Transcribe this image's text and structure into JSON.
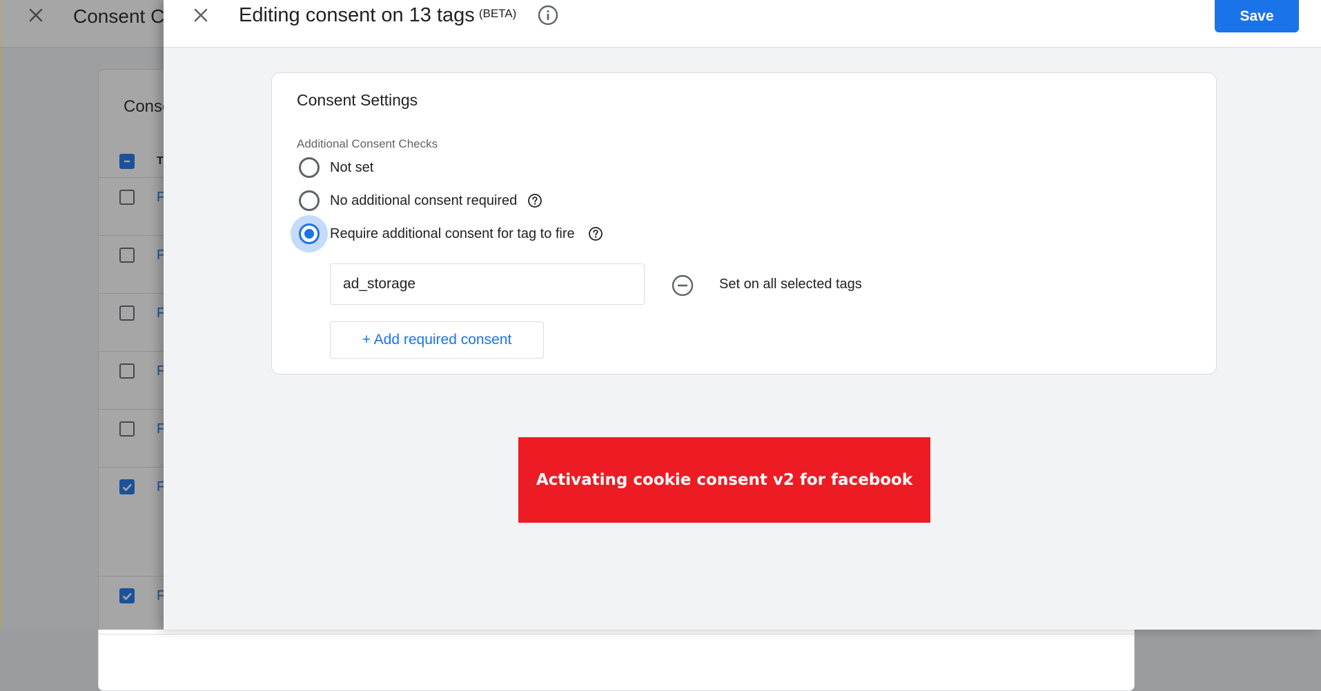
{
  "background_page": {
    "title": "Consent C",
    "card_title": "Conse",
    "table_header_initial": "T",
    "row_link_initial": "F",
    "rows": [
      {
        "checked": false
      },
      {
        "checked": false
      },
      {
        "checked": false
      },
      {
        "checked": false
      },
      {
        "checked": false
      },
      {
        "checked": true
      },
      {
        "checked": true
      }
    ]
  },
  "dialog": {
    "title": "Editing consent on 13 tags",
    "badge": "(BETA)",
    "save_label": "Save",
    "card": {
      "title": "Consent Settings",
      "section_label": "Additional Consent Checks",
      "options": [
        {
          "label": "Not set",
          "selected": false,
          "help": false
        },
        {
          "label": "No additional consent required",
          "selected": false,
          "help": true
        },
        {
          "label": "Require additional consent for tag to fire",
          "selected": true,
          "help": true
        }
      ],
      "consent_value": "ad_storage",
      "set_all_label": "Set on all selected tags",
      "add_button_label": "+ Add required consent"
    }
  },
  "banner": {
    "text": "Activating cookie consent v2 for facebook",
    "color": "#ed1c24"
  },
  "colors": {
    "accent": "#1a73e8"
  }
}
